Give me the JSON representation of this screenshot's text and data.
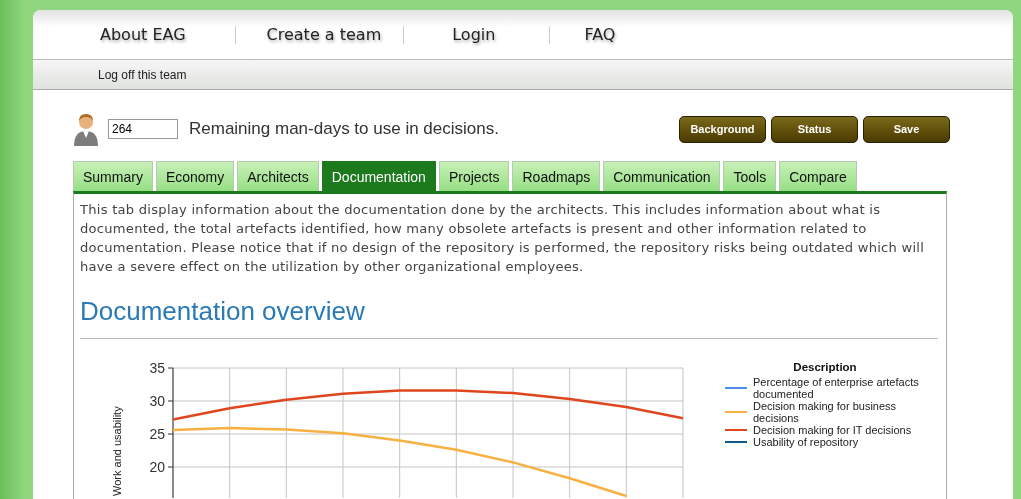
{
  "nav": {
    "items": [
      "About EAG",
      "Create a team",
      "Login",
      "FAQ"
    ]
  },
  "subnav": {
    "link": "Log off this team"
  },
  "team": {
    "man_days": "264",
    "caption": "Remaining man-days to use in decisions."
  },
  "buttons": [
    "Background",
    "Status",
    "Save"
  ],
  "tabs": [
    {
      "label": "Summary",
      "selected": false
    },
    {
      "label": "Economy",
      "selected": false
    },
    {
      "label": "Architects",
      "selected": false
    },
    {
      "label": "Documentation",
      "selected": true
    },
    {
      "label": "Projects",
      "selected": false
    },
    {
      "label": "Roadmaps",
      "selected": false
    },
    {
      "label": "Communication",
      "selected": false
    },
    {
      "label": "Tools",
      "selected": false
    },
    {
      "label": "Compare",
      "selected": false
    }
  ],
  "intro": "This tab display information about the documentation done by the architects. This includes information about what is documented, the total artefacts identified, how many obsolete artefacts is present and other information related to documentation. Please notice that if no design of the repository is performed, the repository risks being outdated which will have a severe effect on the utilization by other organizational employees.",
  "heading": "Documentation overview",
  "chart_data": {
    "type": "line",
    "ylabel": "Work and usability",
    "grid": true,
    "legend": {
      "title": "Description"
    },
    "ylim": [
      15.5,
      35
    ],
    "yticks": [
      20,
      25,
      30,
      35
    ],
    "series": [
      {
        "name": "Percentage of enterprise artefacts documented",
        "color": "#4a90e2",
        "values": [
          null,
          null,
          null,
          null,
          null,
          null,
          null,
          null,
          null,
          null
        ]
      },
      {
        "name": "Decision making for business decisions",
        "color": "#f7b142",
        "values": [
          25.6,
          25.9,
          25.7,
          25.1,
          24.0,
          22.6,
          20.7,
          18.3,
          15.6,
          null
        ]
      },
      {
        "name": "Decision making for IT decisions",
        "color": "#e0461e",
        "values": [
          27.2,
          28.9,
          30.2,
          31.1,
          31.6,
          31.6,
          31.2,
          30.3,
          29.1,
          27.4
        ]
      },
      {
        "name": "Usability of repository",
        "color": "#0f5a8c",
        "values": [
          null,
          null,
          null,
          null,
          null,
          null,
          null,
          null,
          null,
          null
        ]
      }
    ]
  }
}
